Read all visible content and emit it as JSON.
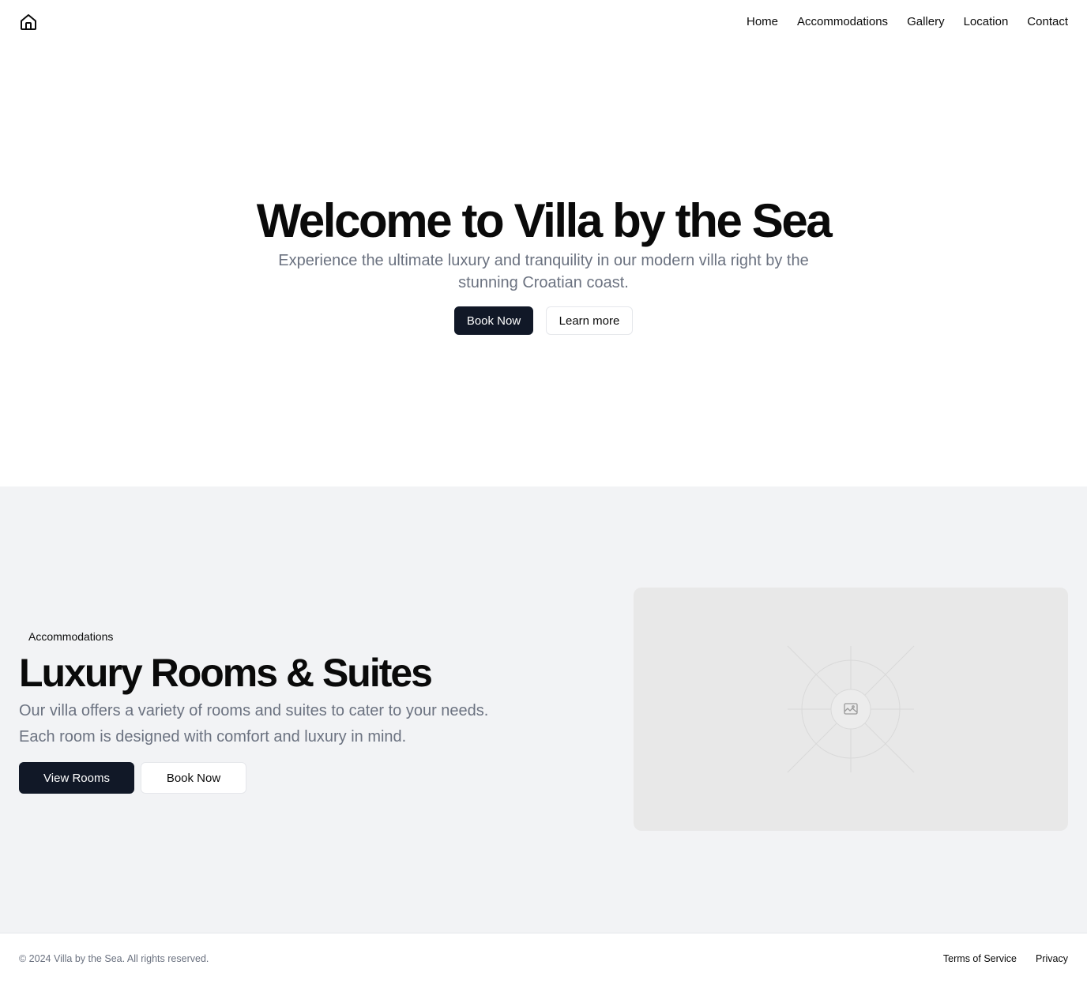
{
  "header": {
    "logo_icon": "home-icon",
    "nav": [
      {
        "label": "Home"
      },
      {
        "label": "Accommodations"
      },
      {
        "label": "Gallery"
      },
      {
        "label": "Location"
      },
      {
        "label": "Contact"
      }
    ]
  },
  "hero": {
    "title": "Welcome to Villa by the Sea",
    "subtitle": "Experience the ultimate luxury and tranquility in our modern villa right by the stunning Croatian coast.",
    "primary_button": "Book Now",
    "secondary_button": "Learn more"
  },
  "accommodations": {
    "badge": "Accommodations",
    "title": "Luxury Rooms & Suites",
    "description": "Our villa offers a variety of rooms and suites to cater to your needs. Each room is designed with comfort and luxury in mind.",
    "primary_button": "View Rooms",
    "secondary_button": "Book Now",
    "image_icon": "image-placeholder-icon"
  },
  "footer": {
    "copyright": "© 2024 Villa by the Sea. All rights reserved.",
    "links": [
      {
        "label": "Terms of Service"
      },
      {
        "label": "Privacy"
      }
    ]
  },
  "colors": {
    "primary_button_bg": "#111827",
    "section_bg": "#f2f3f5",
    "muted_text": "#6b7280",
    "placeholder_bg": "#e8e8e8"
  }
}
